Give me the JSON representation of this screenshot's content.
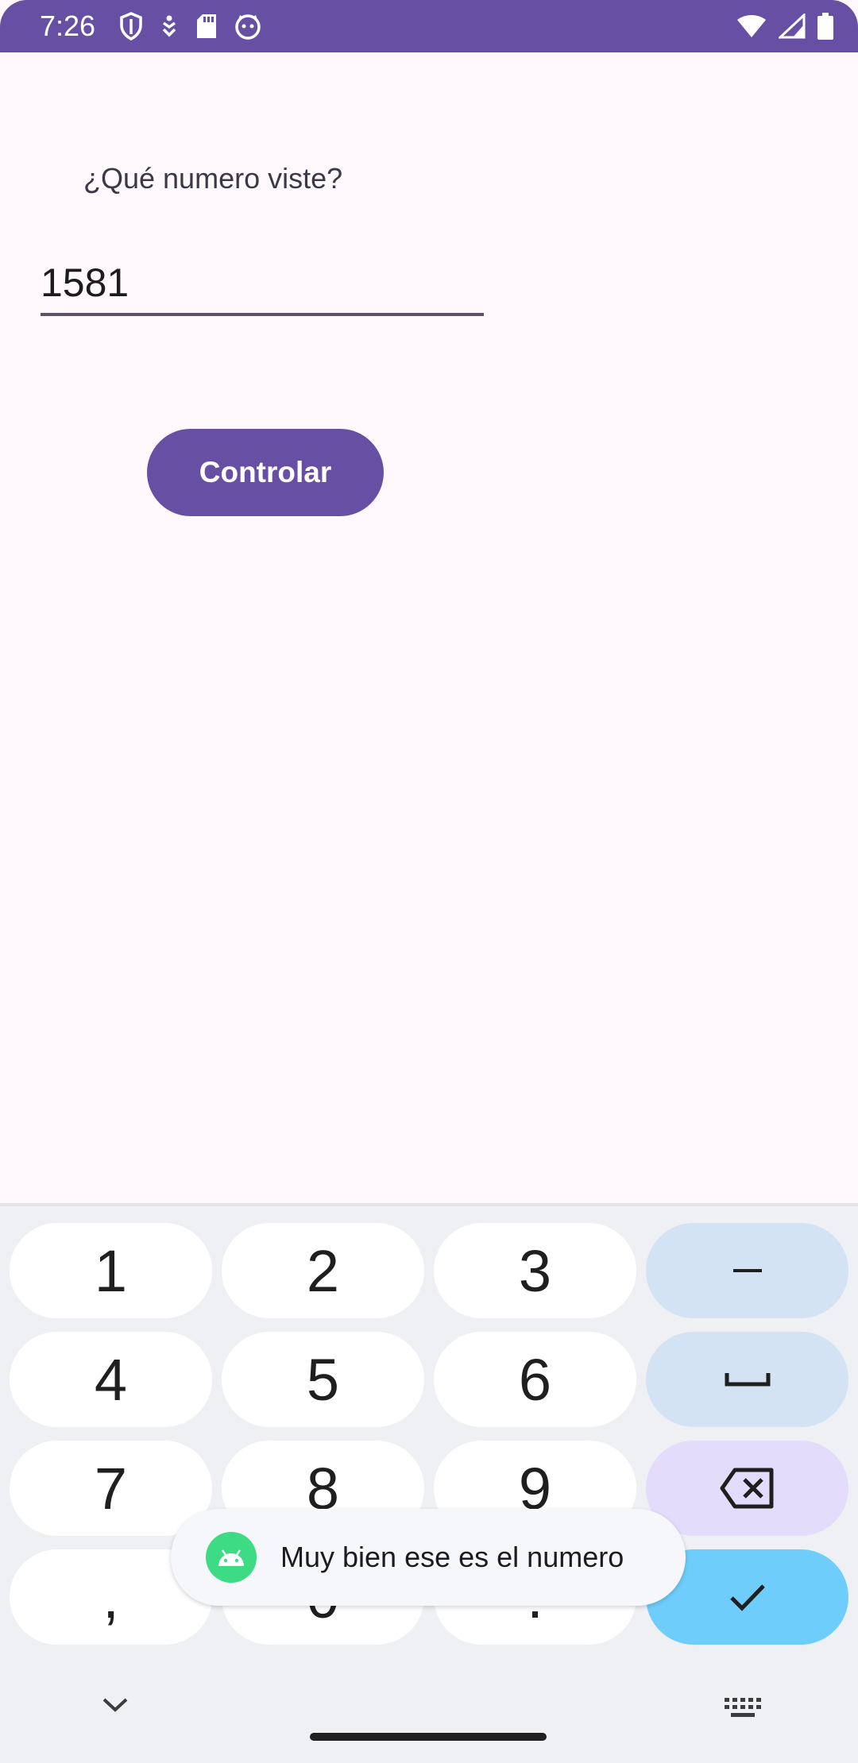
{
  "status_bar": {
    "time": "7:26",
    "left_icons": [
      "shield-icon",
      "tuner-icon",
      "sd-card-icon",
      "cat-face-icon"
    ],
    "right_icons": [
      "wifi-icon",
      "signal-icon",
      "battery-icon"
    ],
    "background": "#6750a4"
  },
  "main": {
    "prompt": "¿Qué numero viste?",
    "number_field_value": "1581",
    "controlar_button": "Controlar"
  },
  "keyboard": {
    "rows": [
      [
        "1",
        "2",
        "3",
        "–"
      ],
      [
        "4",
        "5",
        "6",
        "space"
      ],
      [
        "7",
        "8",
        "9",
        "backspace"
      ],
      [
        ",",
        "0",
        ".",
        "done"
      ]
    ],
    "keys": {
      "k1": "1",
      "k2": "2",
      "k3": "3",
      "minus": "–",
      "k4": "4",
      "k5": "5",
      "k6": "6",
      "k7": "7",
      "k8": "8",
      "k9": "9",
      "comma": ",",
      "k0": "0",
      "period": "."
    },
    "bottom_icons": [
      "chevron-down-icon",
      "keyboard-icon"
    ]
  },
  "toast": {
    "text": "Muy bien ese es el numero",
    "icon": "android-icon"
  },
  "colors": {
    "accent": "#6750a4",
    "page_background": "#fff8fc",
    "keyboard_background": "#eff0f3",
    "function_key": "#d3e3f4",
    "backspace_key": "#e4dcfb",
    "done_key": "#6fcdfb",
    "android_green": "#3ddc84"
  }
}
